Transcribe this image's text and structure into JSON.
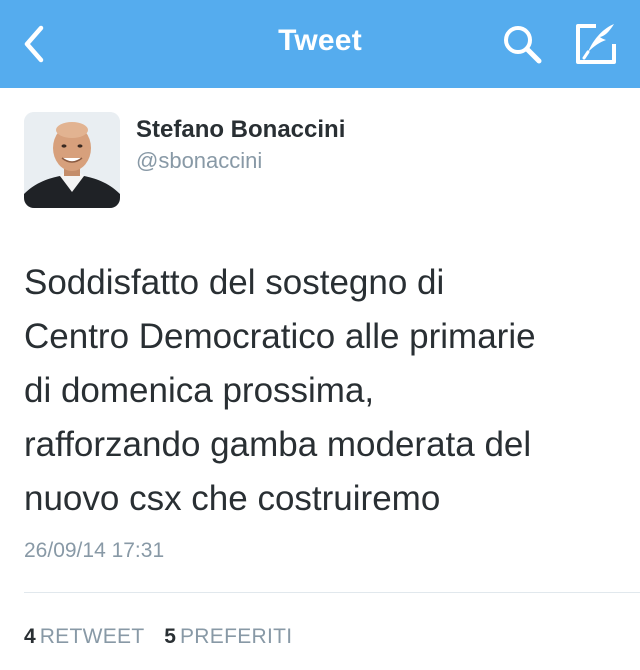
{
  "nav": {
    "title": "Tweet",
    "back_icon": "chevron-left-icon",
    "search_icon": "search-icon",
    "compose_icon": "compose-tweet-icon",
    "background_color": "#55acee"
  },
  "tweet": {
    "author_name": "Stefano Bonaccini",
    "author_handle": "@sbonaccini",
    "text_lines": [
      "Soddisfatto del sostegno di",
      "Centro Democratico alle primarie",
      "di domenica prossima,",
      "rafforzando gamba moderata del",
      "nuovo csx che costruiremo"
    ],
    "timestamp": "26/09/14 17:31"
  },
  "stats": {
    "retweet_count": "4",
    "retweet_label": "RETWEET",
    "favorites_count": "5",
    "favorites_label": "PREFERITI"
  }
}
